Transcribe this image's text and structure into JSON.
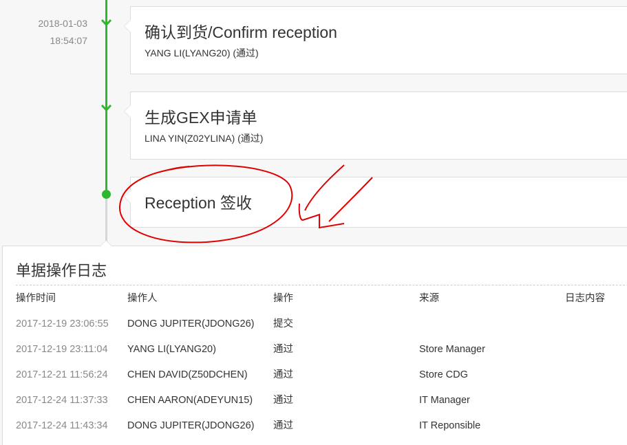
{
  "timeline": {
    "steps": [
      {
        "date": "2018-01-03",
        "time": "18:54:07",
        "title": "确认到货/Confirm reception",
        "detail": "YANG LI(LYANG20) (通过)"
      },
      {
        "title": "生成GEX申请单",
        "detail": "LINA YIN(Z02YLINA) (通过)"
      },
      {
        "title": "Reception 签收"
      }
    ]
  },
  "log": {
    "title": "单据操作日志",
    "headers": {
      "time": "操作时间",
      "operator": "操作人",
      "action": "操作",
      "source": "来源",
      "content": "日志内容"
    },
    "rows": [
      {
        "time": "2017-12-19 23:06:55",
        "operator": "DONG JUPITER(JDONG26)",
        "action": "提交",
        "source": "",
        "content": ""
      },
      {
        "time": "2017-12-19 23:11:04",
        "operator": "YANG LI(LYANG20)",
        "action": "通过",
        "source": "Store Manager",
        "content": ""
      },
      {
        "time": "2017-12-21 11:56:24",
        "operator": "CHEN DAVID(Z50DCHEN)",
        "action": "通过",
        "source": "Store CDG",
        "content": ""
      },
      {
        "time": "2017-12-24 11:37:33",
        "operator": "CHEN AARON(ADEYUN15)",
        "action": "通过",
        "source": "IT Manager",
        "content": ""
      },
      {
        "time": "2017-12-24 11:43:34",
        "operator": "DONG JUPITER(JDONG26)",
        "action": "通过",
        "source": "IT Reponsible",
        "content": ""
      }
    ]
  },
  "colors": {
    "timeline_active": "#2eb82e",
    "timeline_inactive": "#d6d6d6",
    "annotation_red": "#e00000"
  }
}
